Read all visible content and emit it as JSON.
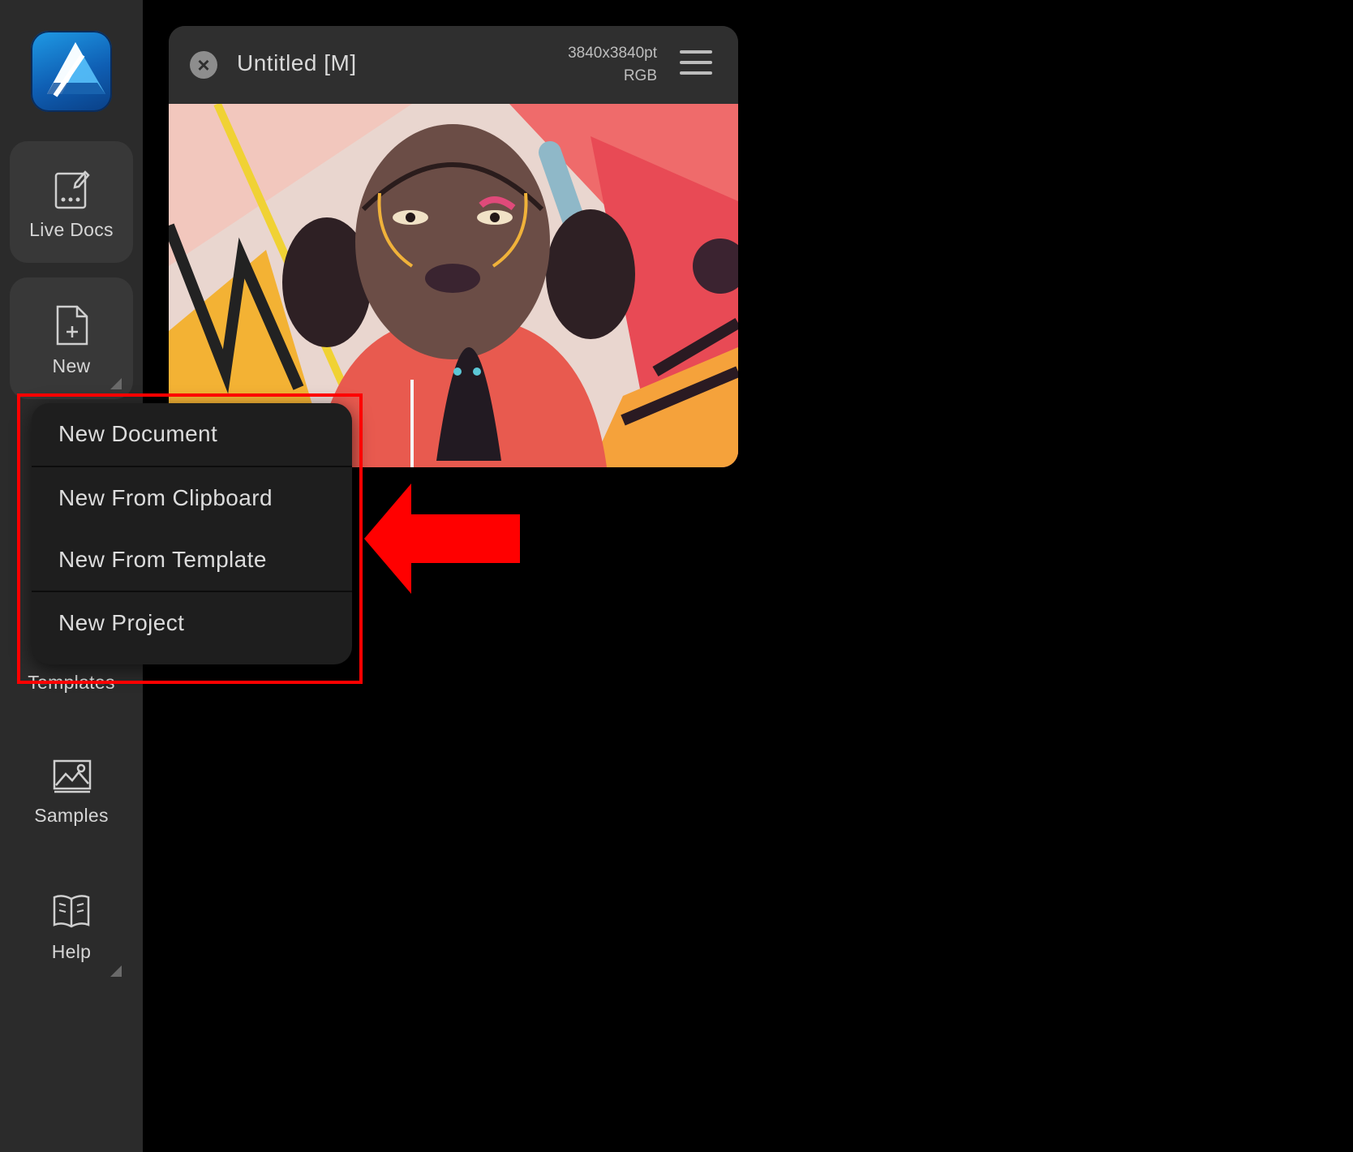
{
  "sidebar": {
    "logo_icon": "affinity-logo-icon",
    "items": [
      {
        "label": "Live Docs",
        "icon": "live-docs-icon"
      },
      {
        "label": "New",
        "icon": "new-document-icon"
      },
      {
        "label": "Templates",
        "icon": "templates-icon"
      },
      {
        "label": "Samples",
        "icon": "samples-icon"
      },
      {
        "label": "Help",
        "icon": "help-book-icon"
      }
    ]
  },
  "document": {
    "title": "Untitled [M]",
    "dimensions": "3840x3840pt",
    "color_mode": "RGB",
    "close_icon": "close-icon",
    "menu_icon": "hamburger-menu-icon"
  },
  "new_menu": {
    "items": [
      {
        "label": "New Document"
      },
      {
        "label": "New From Clipboard"
      },
      {
        "label": "New From Template"
      },
      {
        "label": "New Project"
      }
    ]
  },
  "colors": {
    "highlight": "#ff0000",
    "sidebar_bg": "#2b2b2b",
    "popover_bg": "#1e1e1e",
    "accent_blue": "#1f9be6"
  }
}
